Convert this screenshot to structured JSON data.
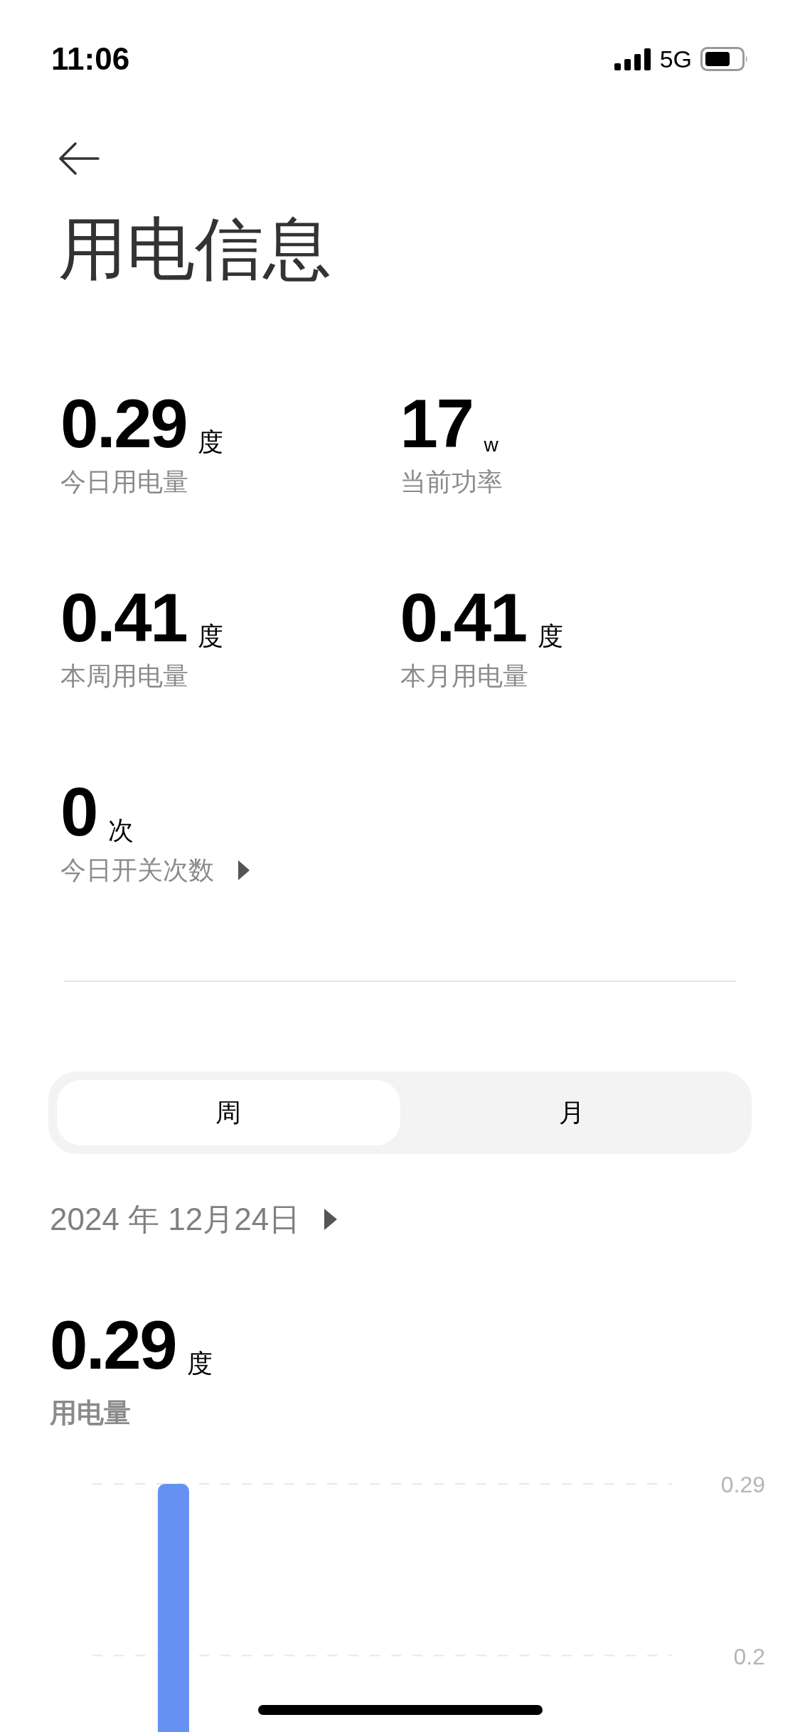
{
  "status_bar": {
    "time": "11:06",
    "network": "5G"
  },
  "title": "用电信息",
  "stats": [
    {
      "kind": "plain",
      "value": "0.29",
      "unit": "度",
      "label": "今日用电量"
    },
    {
      "kind": "plain",
      "value": "17",
      "unit": "w",
      "label": "当前功率"
    },
    {
      "kind": "plain",
      "value": "0.41",
      "unit": "度",
      "label": "本周用电量"
    },
    {
      "kind": "plain",
      "value": "0.41",
      "unit": "度",
      "label": "本月用电量"
    },
    {
      "kind": "link",
      "value": "0",
      "unit": "次",
      "label": "今日开关次数"
    }
  ],
  "tabs": [
    {
      "label": "周",
      "selected": true
    },
    {
      "label": "月",
      "selected": false
    }
  ],
  "date": "2024 年 12月24日",
  "summary": {
    "value": "0.29",
    "unit": "度",
    "label": "用电量"
  },
  "chart_data": {
    "type": "bar",
    "series": [
      {
        "color": "#6690f2",
        "values": [
          0.29
        ]
      }
    ],
    "ylim": [
      0.16,
      0.29
    ],
    "yticks": [
      0.2,
      0.29
    ]
  }
}
